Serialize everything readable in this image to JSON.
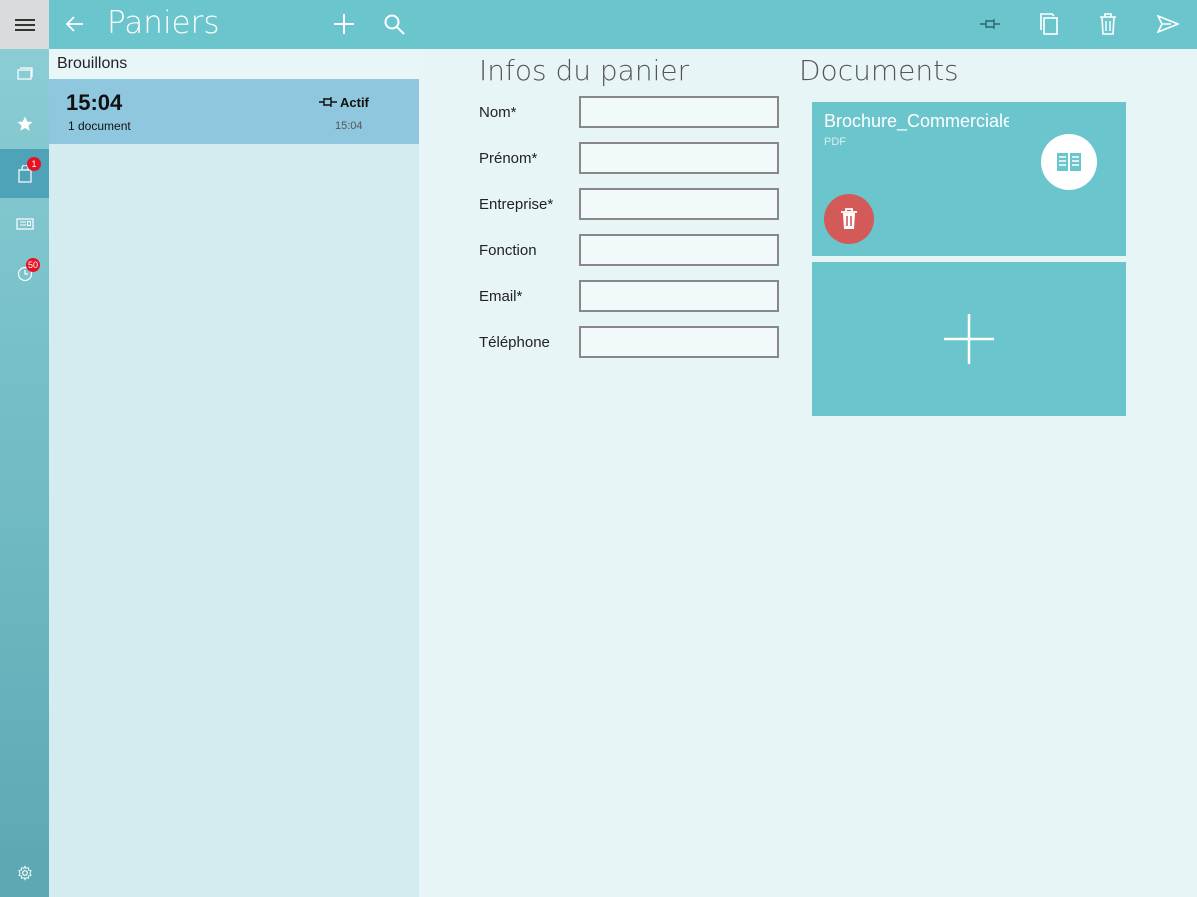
{
  "header": {
    "title": "Paniers"
  },
  "rail": {
    "badges": {
      "paniers": "1",
      "history": "50"
    }
  },
  "list": {
    "section_label": "Brouillons",
    "items": [
      {
        "time": "15:04",
        "documents": "1 document",
        "status": "Actif",
        "status_time": "15:04"
      }
    ]
  },
  "form": {
    "title": "Infos du panier",
    "fields": [
      {
        "label": "Nom*",
        "value": ""
      },
      {
        "label": "Prénom*",
        "value": ""
      },
      {
        "label": "Entreprise*",
        "value": ""
      },
      {
        "label": "Fonction",
        "value": ""
      },
      {
        "label": "Email*",
        "value": ""
      },
      {
        "label": "Téléphone",
        "value": ""
      }
    ]
  },
  "documents": {
    "title": "Documents",
    "items": [
      {
        "name": "Brochure_Commerciale",
        "type": "PDF"
      }
    ]
  },
  "colors": {
    "accent": "#6bc5cc",
    "delete": "#d45a5a",
    "selected_row": "#8fc8de"
  }
}
